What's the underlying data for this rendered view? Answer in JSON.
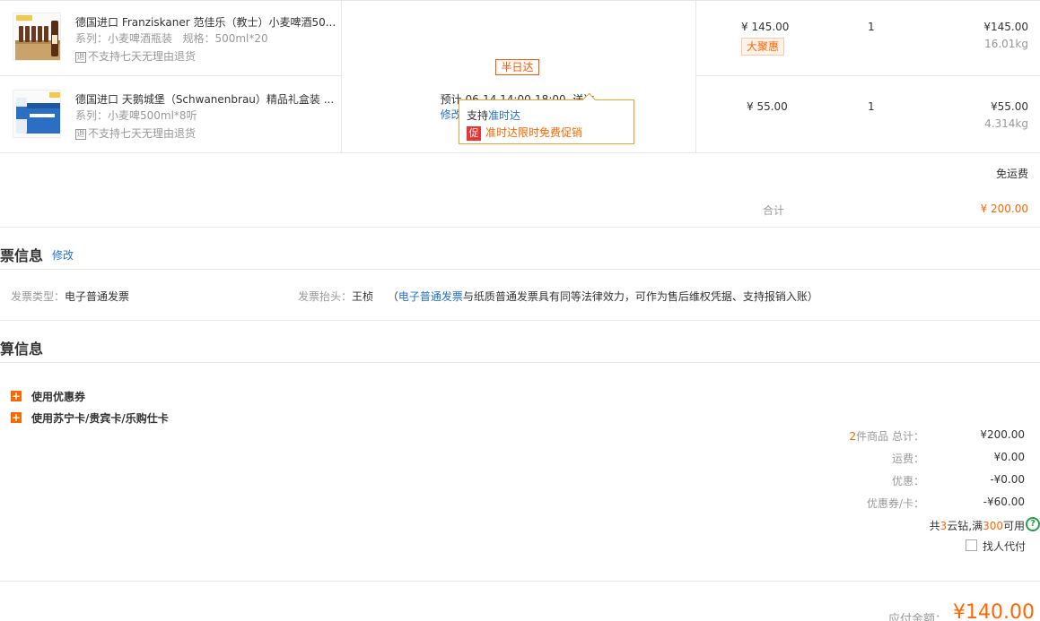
{
  "items": [
    {
      "title": "德国进口 Franziskaner 范佳乐（教士）小麦啤酒50...",
      "series": "系列：小麦啤酒瓶装   规格：500ml*20",
      "no_return": "不支持七天无理由退货",
      "no_return_icon_char": "退",
      "price": "¥ 145.00",
      "tag": "大聚惠",
      "qty": "1",
      "subtotal": "¥145.00",
      "weight": "16.01kg",
      "thumb_icon": "beer-bottles-case"
    },
    {
      "title": "德国进口 天鹅城堡（Schwanenbrau）精品礼盒装 ...",
      "series": "系列：小麦啤500ml*8听",
      "no_return": "不支持七天无理由退货",
      "no_return_icon_char": "退",
      "price": "¥ 55.00",
      "qty": "1",
      "subtotal": "¥55.00",
      "weight": "4.314kg",
      "thumb_icon": "beer-can-giftbox"
    }
  ],
  "delivery": {
    "half_day": "半日达",
    "estimate_prefix": "预计 06-14 14:00-18:00  送达",
    "modify": "修改",
    "support_prefix": "支持",
    "support_link": "准时达",
    "promo_icon": "促",
    "promo_text": "准时达限时免费促销"
  },
  "shipping_free": "免运费",
  "total_label": "合计",
  "total_value": "¥ 200.00",
  "invoice": {
    "title": "票信息",
    "modify": "修改",
    "type_label": "发票类型：",
    "type_value": "电子普通发票",
    "head_label": "发票抬头：",
    "head_value": "王桢",
    "note_open": "（",
    "note_link": "电子普通发票",
    "note_rest": "与纸质普通发票具有同等法律效力，可作为售后维权凭据、支持报销入账）"
  },
  "settlement": {
    "title": "算信息",
    "coupon": "使用优惠券",
    "cards": "使用苏宁卡/贵宾卡/乐购仕卡",
    "plus_char": "+",
    "count_num": "2",
    "count_label": "件商品 总计：",
    "count_value": "¥200.00",
    "freight_label": "运费：",
    "freight_value": "¥0.00",
    "discount_label": "优惠：",
    "discount_value": "-¥0.00",
    "coupon_card_label": "优惠券/卡：",
    "coupon_card_value": "-¥60.00",
    "diamond_prefix": "共",
    "diamond_num": "3",
    "diamond_mid": "云钻,满",
    "diamond_threshold": "300",
    "diamond_suffix": "可用",
    "help_char": "?",
    "proxy_pay": "找人代付"
  },
  "payable_label": "应付金额：",
  "payable_value": "¥140.00"
}
